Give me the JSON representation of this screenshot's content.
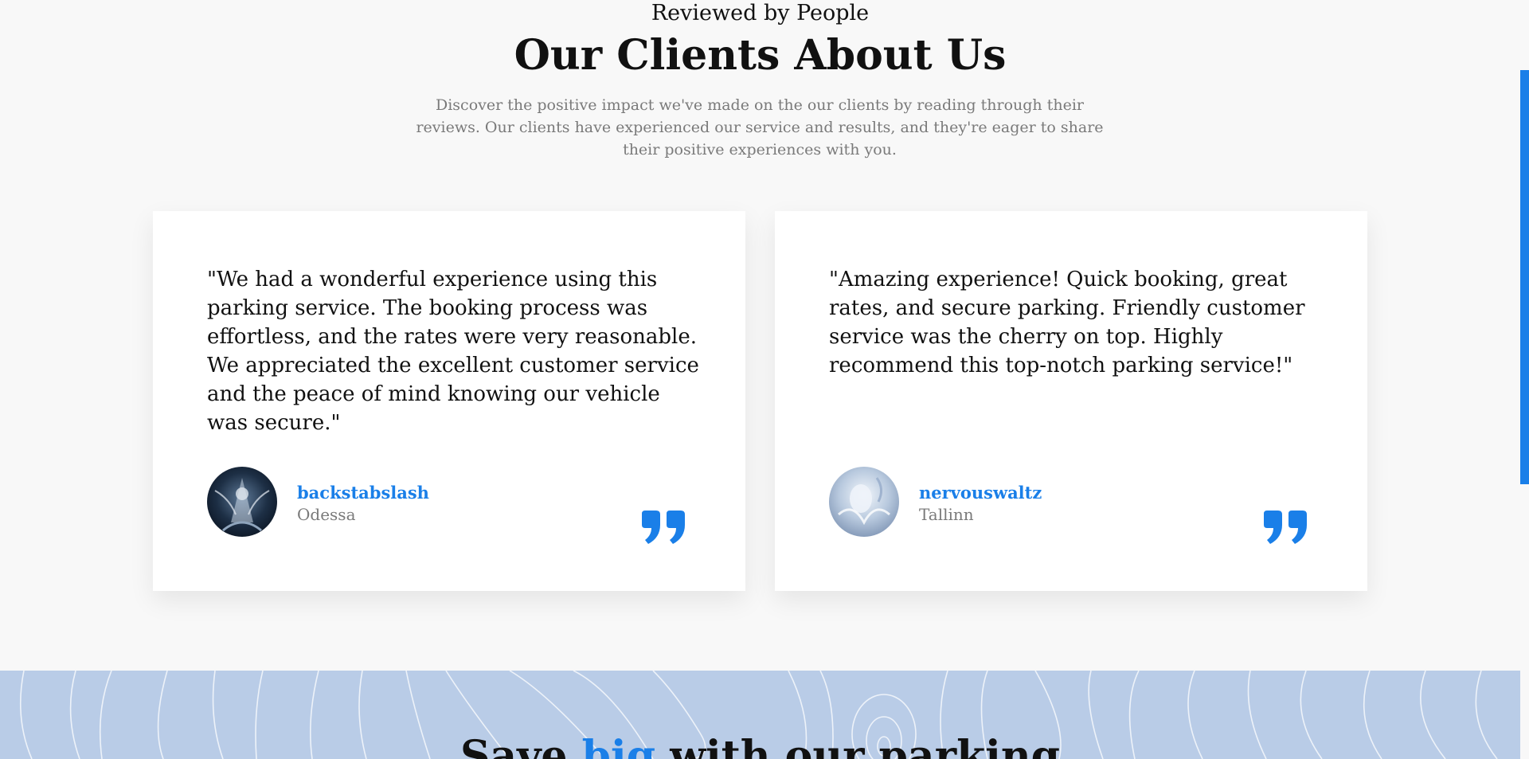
{
  "header": {
    "eyebrow": "Reviewed by People",
    "title": "Our Clients About Us",
    "subtitle": "Discover the positive impact we've made on the our clients by reading through their reviews. Our clients have experienced our service and results, and they're eager to share their positive experiences with you."
  },
  "testimonials": [
    {
      "quote": "\"We had a wonderful experience using this parking service. The booking process was effortless, and the rates were very reasonable. We appreciated the excellent customer service and the peace of mind knowing our vehicle was secure.\"",
      "name": "backstabslash",
      "city": "Odessa"
    },
    {
      "quote": "\"Amazing experience! Quick booking, great rates, and secure parking. Friendly customer service was the cherry on top. Highly recommend this top-notch parking service!\"",
      "name": "nervouswaltz",
      "city": "Tallinn"
    }
  ],
  "banner": {
    "title_before": "Save ",
    "title_accent": "big",
    "title_after": " with our parking"
  },
  "colors": {
    "accent": "#1a7fe8",
    "background": "#f8f8f8",
    "banner": "#b9cce7"
  },
  "icons": {
    "quote": "quote-mark-icon"
  }
}
